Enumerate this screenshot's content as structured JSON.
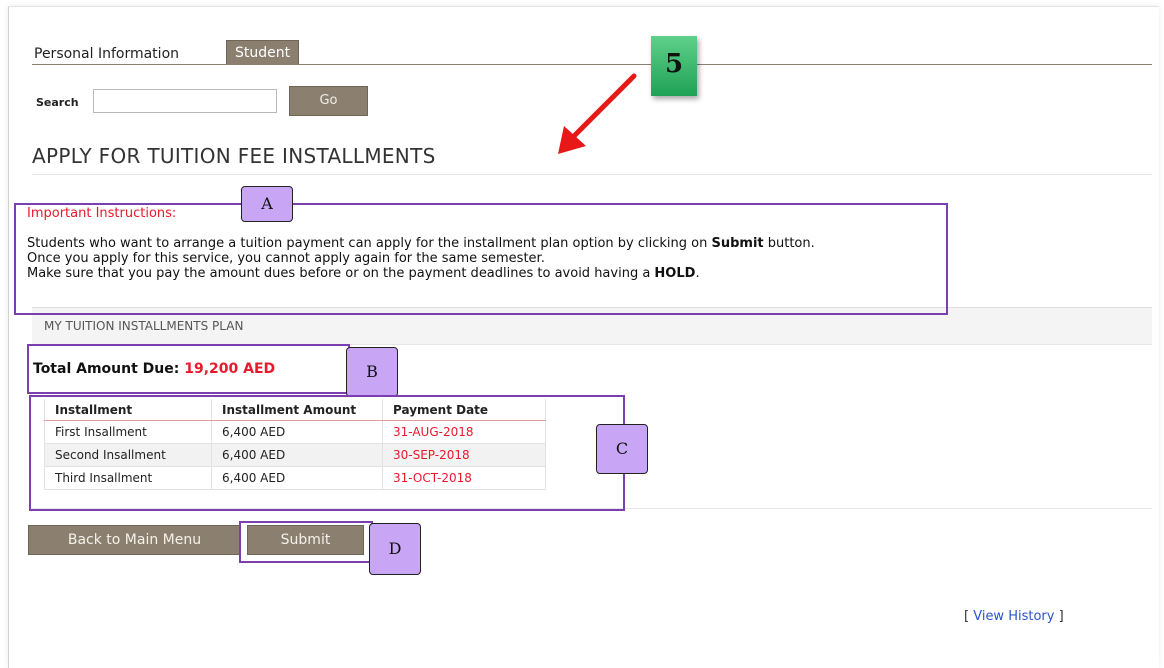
{
  "tabs": [
    {
      "label": "Personal Information",
      "active": false
    },
    {
      "label": "Student",
      "active": true
    }
  ],
  "search": {
    "label": "Search",
    "value": "",
    "button": "Go"
  },
  "page_title": "APPLY FOR TUITION FEE INSTALLMENTS",
  "instructions": {
    "heading": "Important Instructions:",
    "line1_pre": "Students who want to arrange a tuition payment can apply for the installment plan option by clicking on ",
    "line1_bold": "Submit",
    "line1_post": " button.",
    "line2": "Once you apply for this service, you cannot apply again for the same semester.",
    "line3_pre": "Make sure that you pay the amount dues before or on the payment deadlines to avoid having a ",
    "line3_bold": "HOLD",
    "line3_post": "."
  },
  "plan": {
    "section_title": "MY TUITION INSTALLMENTS PLAN",
    "total_label": "Total Amount Due:",
    "total_value": "19,200 AED",
    "columns": [
      "Installment",
      "Installment Amount",
      "Payment Date"
    ],
    "rows": [
      [
        "First Insallment",
        "6,400 AED",
        "31-AUG-2018"
      ],
      [
        "Second Insallment",
        "6,400 AED",
        "30-SEP-2018"
      ],
      [
        "Third Insallment",
        "6,400 AED",
        "31-OCT-2018"
      ]
    ]
  },
  "buttons": {
    "back": "Back to Main Menu",
    "submit": "Submit"
  },
  "history": {
    "open": "[ ",
    "link": "View History",
    "close": " ]"
  },
  "annotations": {
    "step_number": "5",
    "labels": {
      "a": "A",
      "b": "B",
      "c": "C",
      "d": "D"
    },
    "badge_color": "#1fa156",
    "box_color": "#7b3fb0",
    "label_color": "#c9a6f5",
    "arrow_color": "#e81818"
  },
  "colors": {
    "accent_red": "#e8192c",
    "button_brown": "#8b8070",
    "link_blue": "#2a55c8"
  }
}
